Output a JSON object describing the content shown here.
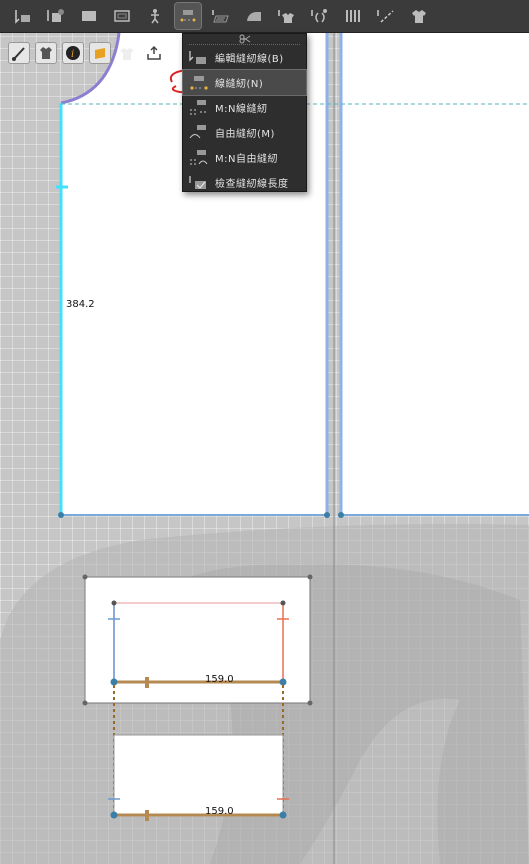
{
  "toolbar": {
    "items": [
      {
        "icon": "select-arrow-icon"
      },
      {
        "icon": "transform-pattern-icon"
      },
      {
        "icon": "rectangle-icon"
      },
      {
        "icon": "internal-rectangle-icon"
      },
      {
        "icon": "avatar-arrange-icon"
      },
      {
        "icon": "segment-sewing-icon",
        "active": true
      },
      {
        "icon": "fold-arrangement-icon"
      },
      {
        "icon": "iron-icon"
      },
      {
        "icon": "tack-icon"
      },
      {
        "icon": "pin-icon"
      },
      {
        "icon": "pleat-icon"
      },
      {
        "icon": "line-tool-icon"
      },
      {
        "icon": "garment-icon"
      }
    ]
  },
  "subtoolbar": {
    "items": [
      {
        "icon": "brush-icon"
      },
      {
        "icon": "shirt-view-icon"
      },
      {
        "icon": "info-icon"
      },
      {
        "icon": "texture-icon"
      },
      {
        "icon": "garment-up-icon"
      },
      {
        "icon": "export-icon"
      }
    ]
  },
  "menu": {
    "items": [
      {
        "label": "編輯縫紉線(B)",
        "selected": false
      },
      {
        "label": "線縫紉(N)",
        "selected": true
      },
      {
        "label": "M:N線縫紉",
        "selected": false
      },
      {
        "label": "自由縫紉(M)",
        "selected": false
      },
      {
        "label": "M:N自由縫紉",
        "selected": false
      },
      {
        "label": "檢查縫紉線長度",
        "selected": false
      }
    ]
  },
  "measurements": {
    "left_edge": "384.2",
    "top_piece": "159.0",
    "bottom_piece": "159.0"
  },
  "colors": {
    "toolbar_bg": "#3b3b3b",
    "seam_cyan": "#40e0ff",
    "seam_orange": "#b48a52",
    "annotation_red": "#e02020"
  }
}
